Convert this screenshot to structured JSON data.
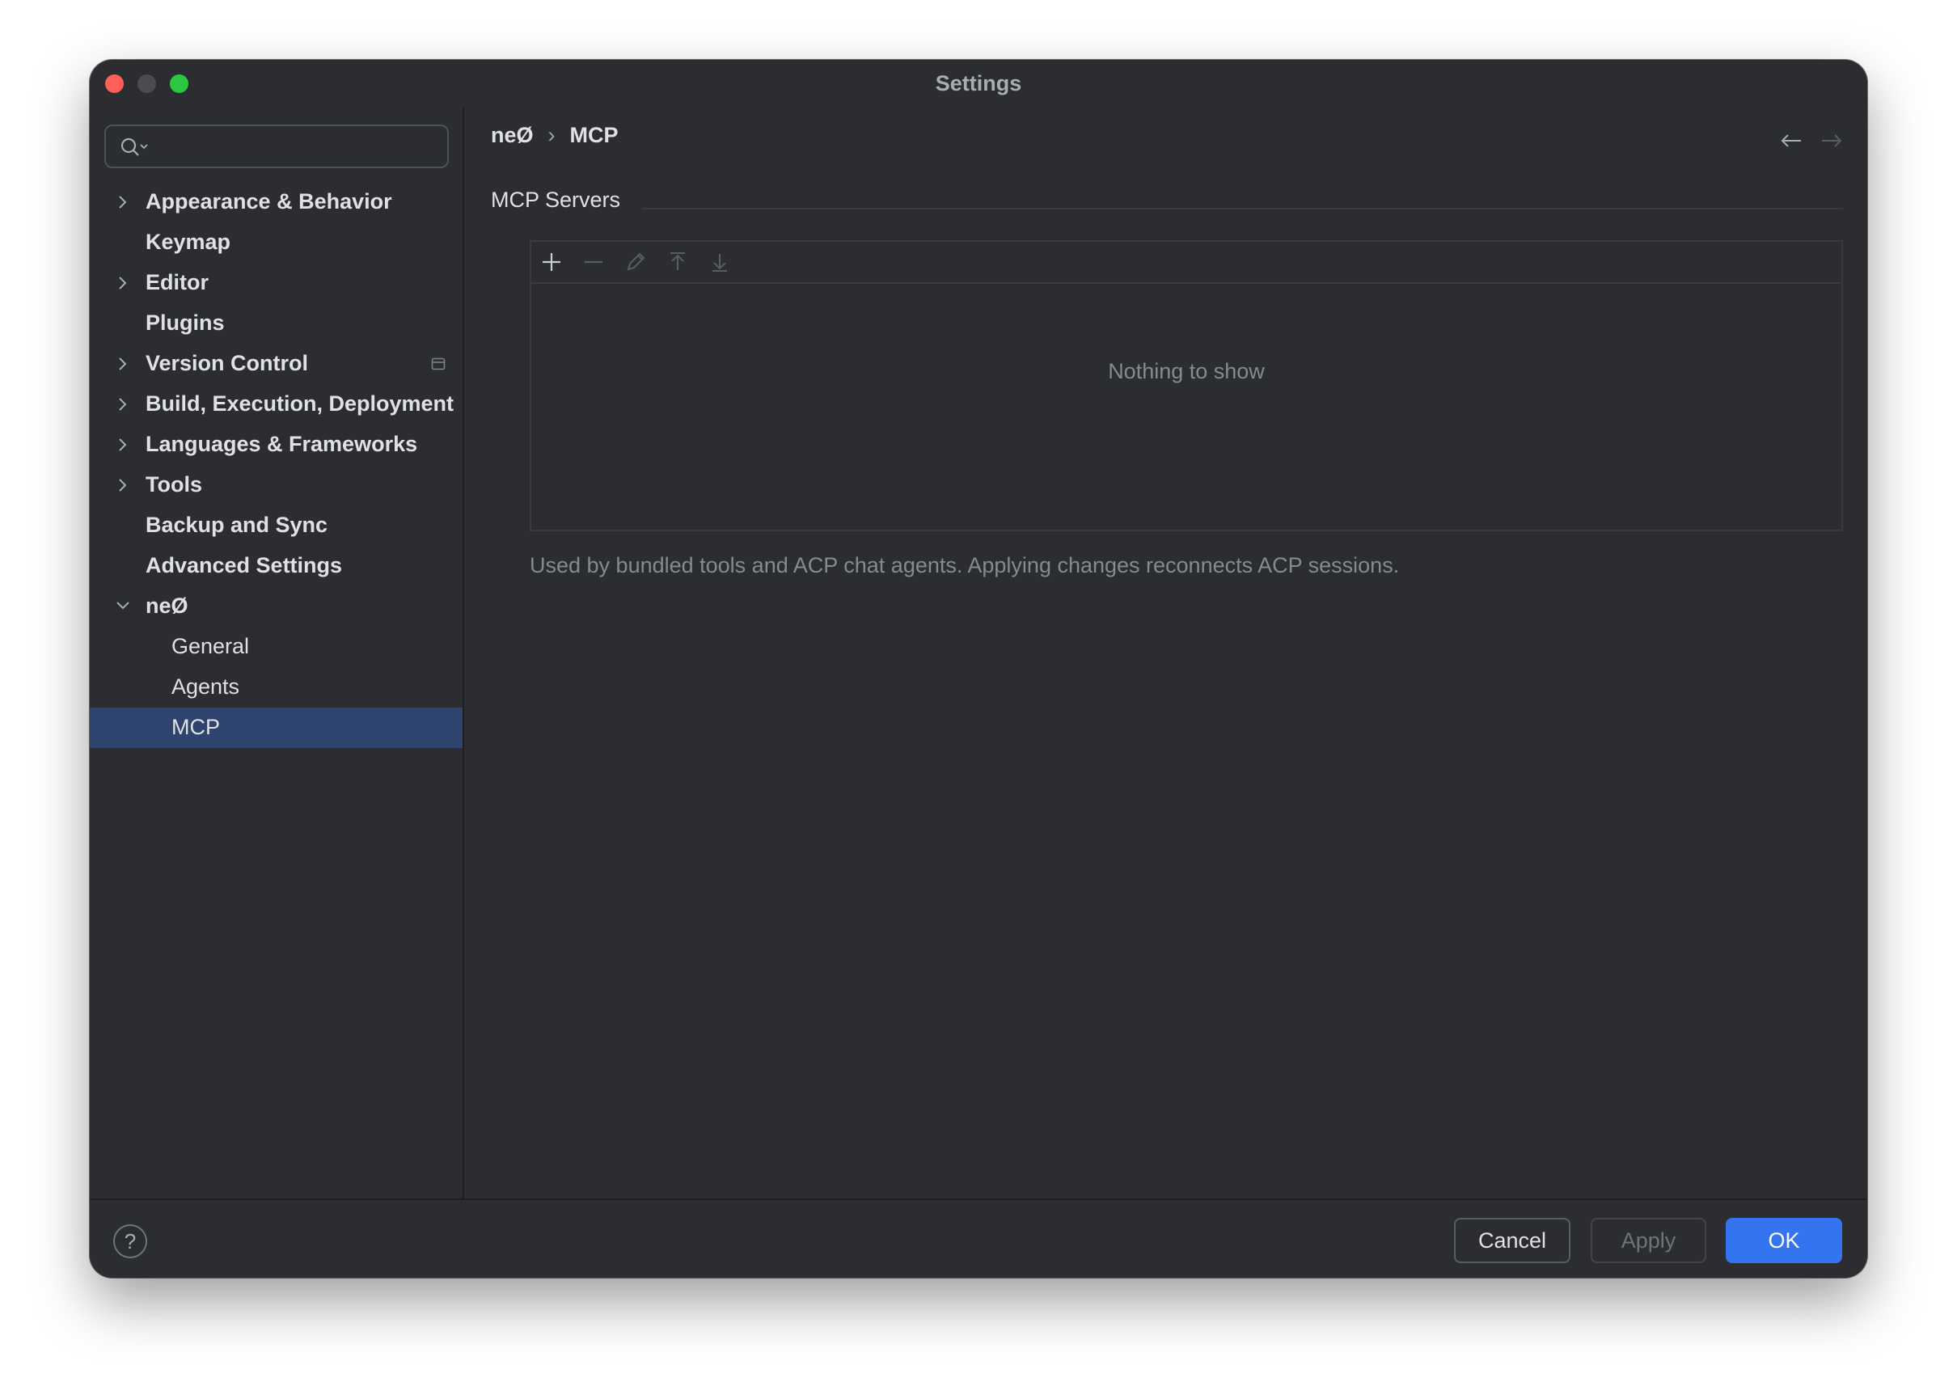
{
  "window": {
    "title": "Settings"
  },
  "search": {
    "placeholder": ""
  },
  "sidebar": {
    "items": [
      {
        "label": "Appearance & Behavior",
        "expandable": true,
        "expanded": false
      },
      {
        "label": "Keymap",
        "expandable": false
      },
      {
        "label": "Editor",
        "expandable": true,
        "expanded": false
      },
      {
        "label": "Plugins",
        "expandable": false
      },
      {
        "label": "Version Control",
        "expandable": true,
        "expanded": false,
        "icon": "project-level-icon"
      },
      {
        "label": "Build, Execution, Deployment",
        "expandable": true,
        "expanded": false
      },
      {
        "label": "Languages & Frameworks",
        "expandable": true,
        "expanded": false
      },
      {
        "label": "Tools",
        "expandable": true,
        "expanded": false
      },
      {
        "label": "Backup and Sync",
        "expandable": false
      },
      {
        "label": "Advanced Settings",
        "expandable": false
      },
      {
        "label": "neØ",
        "expandable": true,
        "expanded": true
      },
      {
        "label": "General",
        "child": true
      },
      {
        "label": "Agents",
        "child": true
      },
      {
        "label": "MCP",
        "child": true,
        "selected": true
      }
    ]
  },
  "breadcrumb": {
    "parent": "neØ",
    "separator": "›",
    "current": "MCP"
  },
  "nav": {
    "back_icon": "arrow-left-icon",
    "forward_icon": "arrow-right-icon"
  },
  "mcp": {
    "section_title": "MCP Servers",
    "toolbar": [
      "add-icon",
      "remove-icon",
      "edit-icon",
      "move-up-icon",
      "move-down-icon"
    ],
    "empty_text": "Nothing to show",
    "hint": "Used by bundled tools and ACP chat agents. Applying changes reconnects ACP sessions."
  },
  "footer": {
    "help": "?",
    "cancel": "Cancel",
    "apply": "Apply",
    "ok": "OK"
  },
  "colors": {
    "background": "#2b2d30",
    "selection": "#2e436e",
    "accent": "#3574f0",
    "text": "#dfe1e5",
    "muted_text": "#868a91"
  }
}
